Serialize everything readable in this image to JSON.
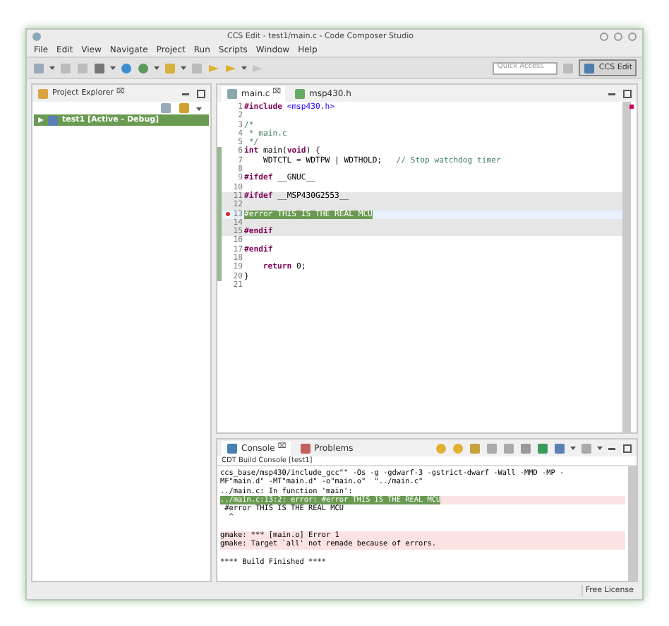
{
  "window": {
    "title": "CCS Edit - test1/main.c - Code Composer Studio"
  },
  "menu": [
    "File",
    "Edit",
    "View",
    "Navigate",
    "Project",
    "Run",
    "Scripts",
    "Window",
    "Help"
  ],
  "quick_access": {
    "placeholder": "Quick Access"
  },
  "perspectives": [
    {
      "label": "CCS Edit",
      "selected": true
    }
  ],
  "project_explorer": {
    "title": "Project Explorer",
    "close": "⌧",
    "tree": [
      {
        "label": "test1  [Active - Debug]",
        "selected": true
      }
    ]
  },
  "editor": {
    "tabs": [
      {
        "label": "main.c",
        "close": "⌧",
        "selected": true
      },
      {
        "label": "msp430.h",
        "selected": false
      }
    ],
    "lines": [
      {
        "number": "1",
        "segments": [
          {
            "kind": "keyword",
            "text": "#include"
          },
          {
            "kind": "string",
            "text": " <msp430.h>"
          }
        ]
      },
      {
        "number": "2"
      },
      {
        "number": "3",
        "segments": [
          {
            "kind": "comment",
            "text": "/*"
          }
        ]
      },
      {
        "number": "4",
        "segments": [
          {
            "kind": "comment",
            "text": " * main.c"
          }
        ]
      },
      {
        "number": "5",
        "segments": [
          {
            "kind": "comment",
            "text": " */"
          }
        ]
      },
      {
        "number": "6",
        "segments": [
          {
            "kind": "keyword",
            "text": "int"
          },
          {
            "kind": "plain",
            "text": " main("
          },
          {
            "kind": "keyword",
            "text": "void"
          },
          {
            "kind": "plain",
            "text": ") {"
          }
        ]
      },
      {
        "number": "7",
        "segments": [
          {
            "kind": "plain",
            "text": "    WDTCTL = WDTPW | WDTHOLD;   "
          },
          {
            "kind": "comment",
            "text": "// Stop watchdog timer"
          }
        ]
      },
      {
        "number": "8"
      },
      {
        "number": "9",
        "segments": [
          {
            "kind": "keyword",
            "text": "#ifdef"
          },
          {
            "kind": "plain",
            "text": " __GNUC__"
          }
        ]
      },
      {
        "number": "10"
      },
      {
        "number": "11",
        "inactive": true,
        "segments": [
          {
            "kind": "keyword",
            "text": "#ifdef"
          },
          {
            "kind": "plain",
            "text": " __MSP430G2553__"
          }
        ]
      },
      {
        "number": "12",
        "inactive": true
      },
      {
        "number": "13",
        "current": true,
        "error": true,
        "segments": [
          {
            "kind": "selected",
            "text": "#error THIS IS THE REAL MCU"
          }
        ]
      },
      {
        "number": "14",
        "inactive": true
      },
      {
        "number": "15",
        "inactive": true,
        "segments": [
          {
            "kind": "keyword",
            "text": "#endif"
          }
        ]
      },
      {
        "number": "16"
      },
      {
        "number": "17",
        "segments": [
          {
            "kind": "keyword",
            "text": "#endif"
          }
        ]
      },
      {
        "number": "18"
      },
      {
        "number": "19",
        "indented": true,
        "segments": [
          {
            "kind": "keyword",
            "text": "return"
          },
          {
            "kind": "plain",
            "text": " 0;"
          }
        ]
      },
      {
        "number": "20",
        "segments": [
          {
            "kind": "plain",
            "text": "}"
          }
        ]
      },
      {
        "number": "21"
      }
    ]
  },
  "console": {
    "tabs": [
      {
        "label": "Console",
        "close": "⌧",
        "selected": true
      },
      {
        "label": "Problems",
        "selected": false
      }
    ],
    "subtitle": "CDT Build Console [test1]",
    "lines": [
      {
        "kind": "plain",
        "text": "ccs_base/msp430/include_gcc\"\" -Os -g -gdwarf-3 -gstrict-dwarf -Wall -MMD -MP -"
      },
      {
        "kind": "plain",
        "text": "MF\"main.d\" -MT\"main.d\" -o\"main.o\"  \"../main.c\""
      },
      {
        "kind": "plain",
        "text": "../main.c: In function 'main':"
      },
      {
        "kind": "error_link",
        "text": "../main.c:13:2: error: #error THIS IS THE REAL MCU"
      },
      {
        "kind": "plain",
        "text": " #error THIS IS THE REAL MCU"
      },
      {
        "kind": "plain",
        "text": "  ^"
      },
      {
        "kind": "blank"
      },
      {
        "kind": "error",
        "text": "gmake: *** [main.o] Error 1"
      },
      {
        "kind": "error",
        "text": "gmake: Target `all' not remade because of errors."
      },
      {
        "kind": "blank"
      },
      {
        "kind": "plain",
        "text": "**** Build Finished ****"
      }
    ]
  },
  "status_bar": {
    "license": "Free License"
  }
}
